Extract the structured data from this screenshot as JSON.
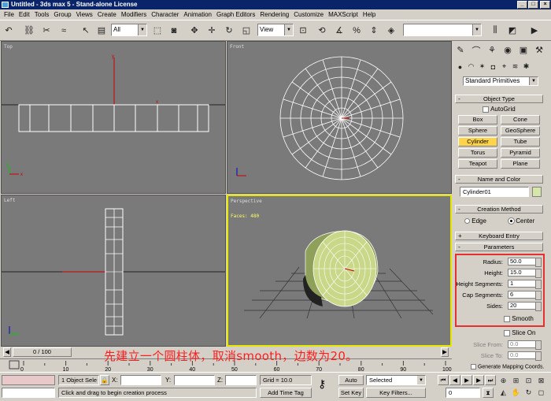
{
  "window": {
    "title": "Untitled - 3ds max 5 - Stand-alone License"
  },
  "menu": [
    "File",
    "Edit",
    "Tools",
    "Group",
    "Views",
    "Create",
    "Modifiers",
    "Character",
    "Animation",
    "Graph Editors",
    "Rendering",
    "Customize",
    "MAXScript",
    "Help"
  ],
  "toolbar": {
    "selection_filter": "All",
    "ref_coord": "View"
  },
  "viewports": {
    "top": "Top",
    "front": "Front",
    "left": "Left",
    "perspective": "Perspective",
    "faces": "Faces: 480"
  },
  "panel": {
    "category_dropdown": "Standard Primitives",
    "object_type_title": "Object Type",
    "autogrid_label": "AutoGrid",
    "buttons": [
      "Box",
      "Cone",
      "Sphere",
      "GeoSphere",
      "Cylinder",
      "Tube",
      "Torus",
      "Pyramid",
      "Teapot",
      "Plane"
    ],
    "active_button": "Cylinder",
    "name_color_title": "Name and Color",
    "object_name": "Cylinder01",
    "name_swatch_color": "#d6e6a8",
    "creation_method_title": "Creation Method",
    "edge_label": "Edge",
    "center_label": "Center",
    "keyboard_entry_title": "Keyboard Entry",
    "parameters_title": "Parameters",
    "params": [
      {
        "label": "Radius:",
        "value": "50.0"
      },
      {
        "label": "Height:",
        "value": "15.0"
      },
      {
        "label": "Height Segments:",
        "value": "1"
      },
      {
        "label": "Cap Segments:",
        "value": "6"
      },
      {
        "label": "Sides:",
        "value": "20"
      }
    ],
    "smooth_label": "Smooth",
    "slice_on_label": "Slice On",
    "slice_from_label": "Slice From:",
    "slice_from_value": "0.0",
    "slice_to_label": "Slice To:",
    "slice_to_value": "0.0",
    "generate_label": "Generate Mapping Coords."
  },
  "timeline": {
    "frame_readout": "0 / 100",
    "ticks": [
      "0",
      "10",
      "20",
      "30",
      "40",
      "50",
      "60",
      "70",
      "80",
      "90",
      "100"
    ]
  },
  "status": {
    "selection": "1 Object Sele",
    "x_label": "X:",
    "y_label": "Y:",
    "z_label": "Z:",
    "grid": "Grid = 10.0",
    "prompt": "Click and drag to begin creation process",
    "add_time_tag": "Add Time Tag",
    "auto_key": "Auto Key",
    "set_key": "Set Key",
    "key_mode": "Selected",
    "key_filters": "Key Filters...",
    "current_frame": "0"
  },
  "caption": "先建立一个圆柱体，取消smooth，边数为20。",
  "colors": {
    "active_button": "#ffd34a",
    "caption": "#ff1e1e",
    "highlight_box": "#e53030"
  }
}
